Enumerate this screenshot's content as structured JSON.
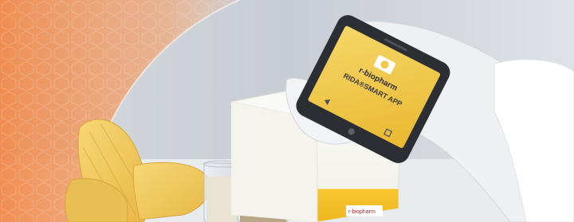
{
  "phone_screen": {
    "brand": "r-biopharm",
    "app_name": "RIDA®SMART APP"
  },
  "box": {
    "brand": "r-biopharm"
  },
  "colors": {
    "accent_orange": "#f08a4b",
    "screen_yellow": "#f2c94c",
    "box_yellow": "#f7c62f"
  }
}
